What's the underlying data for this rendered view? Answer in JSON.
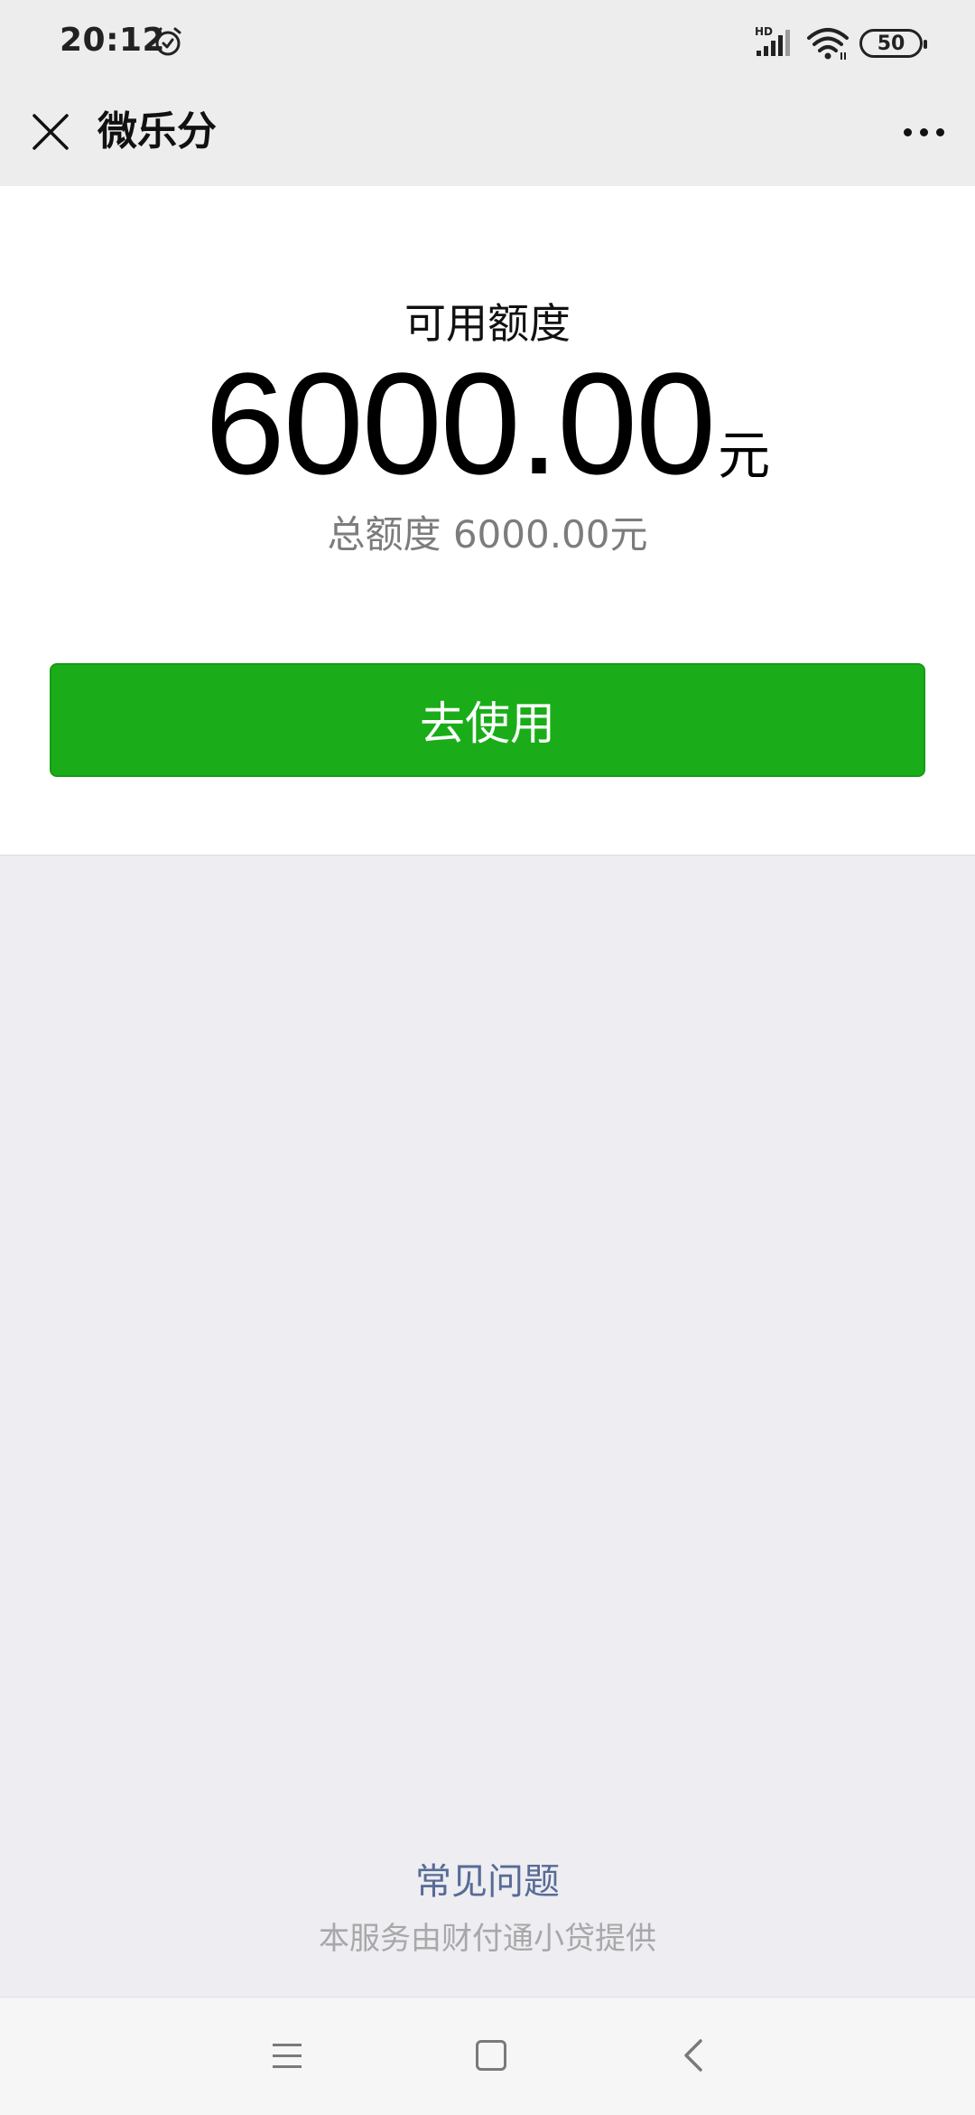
{
  "status_bar": {
    "time": "20:12",
    "alarm_icon": "alarm-clock-icon",
    "signal_icon": "hd-signal-icon",
    "wifi_icon": "wifi-icon",
    "battery_level": "50"
  },
  "nav": {
    "close_icon": "close-icon",
    "title": "微乐分",
    "more_icon": "more-dots-icon"
  },
  "credit": {
    "available_label": "可用额度",
    "available_amount": "6000.00",
    "unit": "元",
    "total_line": "总额度 6000.00元",
    "use_button_label": "去使用",
    "use_button_color": "#1AAD19"
  },
  "footer": {
    "faq_label": "常见问题",
    "faq_color": "#576B95",
    "provider_text": "本服务由财付通小贷提供"
  },
  "system_nav": {
    "menu_icon": "menu-lines-icon",
    "home_icon": "home-square-icon",
    "back_icon": "back-chevron-icon"
  }
}
